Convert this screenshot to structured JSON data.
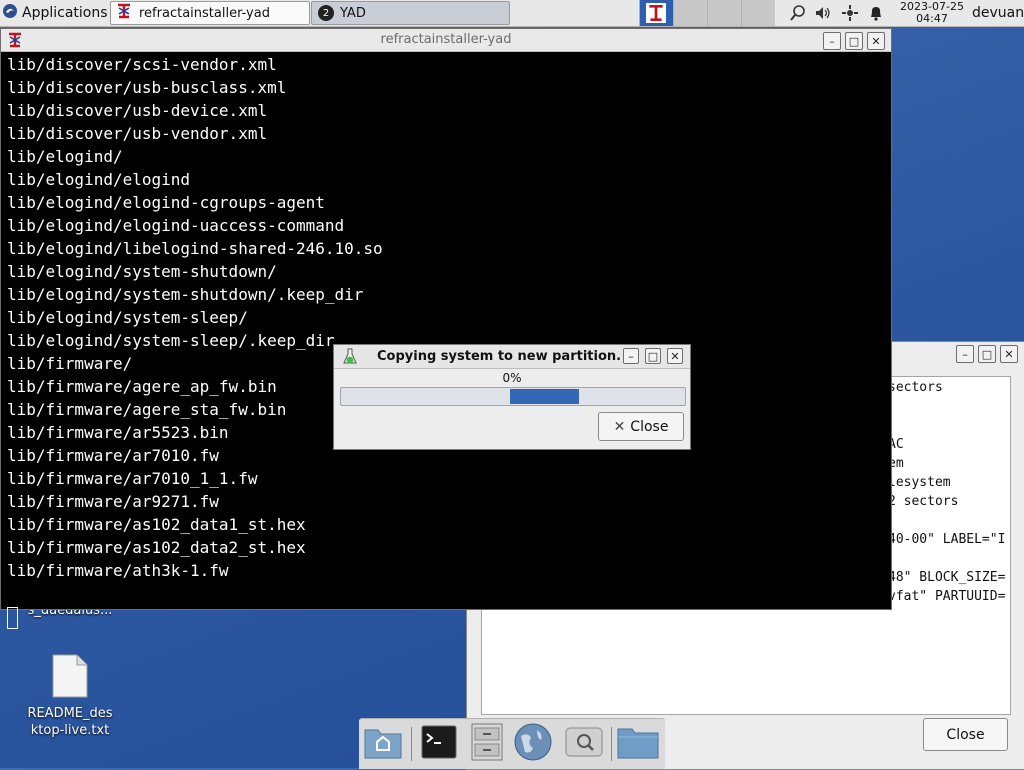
{
  "panel": {
    "applications_label": "Applications",
    "tasks": [
      {
        "label": "refractainstaller-yad"
      },
      {
        "label": "YAD",
        "badge": "2"
      }
    ],
    "clock_date": "2023-07-25",
    "clock_time": "04:47",
    "user": "devuan"
  },
  "terminal": {
    "title": "refractainstaller-yad",
    "lines": [
      "lib/discover/scsi-vendor.xml",
      "lib/discover/usb-busclass.xml",
      "lib/discover/usb-device.xml",
      "lib/discover/usb-vendor.xml",
      "lib/elogind/",
      "lib/elogind/elogind",
      "lib/elogind/elogind-cgroups-agent",
      "lib/elogind/elogind-uaccess-command",
      "lib/elogind/libelogind-shared-246.10.so",
      "lib/elogind/system-shutdown/",
      "lib/elogind/system-shutdown/.keep_dir",
      "lib/elogind/system-sleep/",
      "lib/elogind/system-sleep/.keep_dir",
      "lib/firmware/",
      "lib/firmware/agere_ap_fw.bin",
      "lib/firmware/agere_sta_fw.bin",
      "lib/firmware/ar5523.bin",
      "lib/firmware/ar7010.fw",
      "lib/firmware/ar7010_1_1.fw",
      "lib/firmware/ar9271.fw",
      "lib/firmware/as102_data1_st.hex",
      "lib/firmware/as102_data2_st.hex",
      "lib/firmware/ath3k-1.fw"
    ]
  },
  "progress_dialog": {
    "title": "Copying system to new partition.",
    "percent_text": "0%",
    "close_label": "Close"
  },
  "background_window": {
    "lines": [
      "sectors",
      "AC",
      "em",
      "lesystem",
      "2 sectors",
      "40-00\" LABEL=\"I",
      "48\" BLOCK_SIZE=",
      "vfat\" PARTUUID="
    ],
    "close_label": "Close"
  },
  "desktop": {
    "partial_label": "s_daedalus...",
    "readme_line1": "README_des",
    "readme_line2": "ktop-live.txt"
  }
}
